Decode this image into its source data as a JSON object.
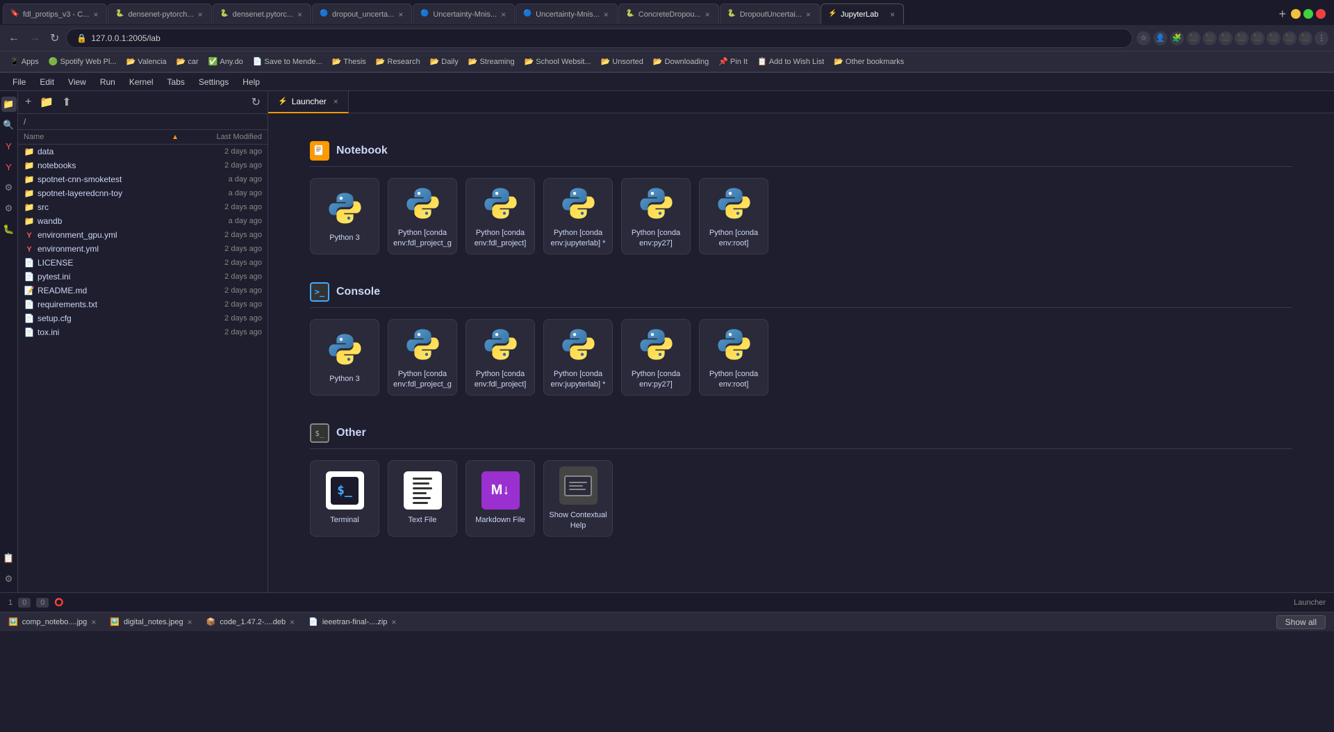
{
  "browser": {
    "tabs": [
      {
        "id": "t1",
        "favicon": "🔖",
        "favicon_color": "fav-orange",
        "title": "fdl_protips_v3 - C...",
        "active": false,
        "closable": true
      },
      {
        "id": "t2",
        "favicon": "🐍",
        "favicon_color": "fav-blue",
        "title": "densenet-pytorch...",
        "active": false,
        "closable": true
      },
      {
        "id": "t3",
        "favicon": "🐍",
        "favicon_color": "fav-blue",
        "title": "densenet.pytorc...",
        "active": false,
        "closable": true
      },
      {
        "id": "t4",
        "favicon": "🔵",
        "favicon_color": "fav-blue",
        "title": "dropout_uncerta...",
        "active": false,
        "closable": true
      },
      {
        "id": "t5",
        "favicon": "🔵",
        "favicon_color": "fav-blue",
        "title": "Uncertainty-Mnis...",
        "active": false,
        "closable": true
      },
      {
        "id": "t6",
        "favicon": "🔵",
        "favicon_color": "fav-blue",
        "title": "Uncertainty-Mnis...",
        "active": false,
        "closable": true
      },
      {
        "id": "t7",
        "favicon": "🐍",
        "favicon_color": "fav-blue",
        "title": "ConcreteDropou...",
        "active": false,
        "closable": true
      },
      {
        "id": "t8",
        "favicon": "🐍",
        "favicon_color": "fav-blue",
        "title": "DropoutUncertai...",
        "active": false,
        "closable": true
      },
      {
        "id": "t9",
        "favicon": "⚡",
        "favicon_color": "fav-orange",
        "title": "JupyterLab",
        "active": true,
        "closable": true
      }
    ],
    "url": "127.0.0.1:2005/lab",
    "bookmarks": [
      {
        "icon": "📱",
        "label": "Apps"
      },
      {
        "icon": "🟢",
        "label": "Spotify Web Pl..."
      },
      {
        "icon": "📂",
        "label": "Valencia"
      },
      {
        "icon": "📂",
        "label": "car"
      },
      {
        "icon": "✅",
        "label": "Any.do"
      },
      {
        "icon": "📄",
        "label": "Save to Mende..."
      },
      {
        "icon": "📂",
        "label": "Thesis"
      },
      {
        "icon": "📂",
        "label": "Research"
      },
      {
        "icon": "📂",
        "label": "Daily"
      },
      {
        "icon": "📂",
        "label": "Streaming"
      },
      {
        "icon": "📂",
        "label": "School Websit..."
      },
      {
        "icon": "📂",
        "label": "Unsorted"
      },
      {
        "icon": "📂",
        "label": "Downloading"
      },
      {
        "icon": "📌",
        "label": "Pin It"
      },
      {
        "icon": "📋",
        "label": "Add to Wish List"
      },
      {
        "icon": "📂",
        "label": "Other bookmarks"
      }
    ]
  },
  "app": {
    "menu_items": [
      "File",
      "Edit",
      "View",
      "Run",
      "Kernel",
      "Tabs",
      "Settings",
      "Help"
    ]
  },
  "sidebar_icons": [
    "files",
    "search",
    "git",
    "extensions",
    "build",
    "debug"
  ],
  "file_panel": {
    "breadcrumb": "/",
    "columns": {
      "name": "Name",
      "modified": "Last Modified"
    },
    "sort_icon": "▲",
    "items": [
      {
        "type": "folder",
        "name": "data",
        "modified": "2 days ago"
      },
      {
        "type": "folder",
        "name": "notebooks",
        "modified": "2 days ago"
      },
      {
        "type": "folder",
        "name": "spotnet-cnn-smoketest",
        "modified": "a day ago"
      },
      {
        "type": "folder",
        "name": "spotnet-layeredcnn-toy",
        "modified": "a day ago"
      },
      {
        "type": "folder",
        "name": "src",
        "modified": "2 days ago"
      },
      {
        "type": "folder",
        "name": "wandb",
        "modified": "a day ago"
      },
      {
        "type": "yaml",
        "name": "environment_gpu.yml",
        "modified": "2 days ago"
      },
      {
        "type": "yaml",
        "name": "environment.yml",
        "modified": "2 days ago"
      },
      {
        "type": "file",
        "name": "LICENSE",
        "modified": "2 days ago"
      },
      {
        "type": "file",
        "name": "pytest.ini",
        "modified": "2 days ago"
      },
      {
        "type": "markdown",
        "name": "README.md",
        "modified": "2 days ago"
      },
      {
        "type": "file",
        "name": "requirements.txt",
        "modified": "2 days ago"
      },
      {
        "type": "file",
        "name": "setup.cfg",
        "modified": "2 days ago"
      },
      {
        "type": "file",
        "name": "tox.ini",
        "modified": "2 days ago"
      }
    ]
  },
  "launcher": {
    "tab_label": "Launcher",
    "sections": {
      "notebook": {
        "title": "Notebook",
        "kernels": [
          {
            "label": "Python 3"
          },
          {
            "label": "Python [conda env:fdl_project_g"
          },
          {
            "label": "Python [conda env:fdl_project]"
          },
          {
            "label": "Python [conda env:jupyterlab] *"
          },
          {
            "label": "Python [conda env:py27]"
          },
          {
            "label": "Python [conda env:root]"
          }
        ]
      },
      "console": {
        "title": "Console",
        "kernels": [
          {
            "label": "Python 3"
          },
          {
            "label": "Python [conda env:fdl_project_g"
          },
          {
            "label": "Python [conda env:fdl_project]"
          },
          {
            "label": "Python [conda env:jupyterlab] *"
          },
          {
            "label": "Python [conda env:py27]"
          },
          {
            "label": "Python [conda env:root]"
          }
        ]
      },
      "other": {
        "title": "Other",
        "items": [
          {
            "type": "terminal",
            "label": "Terminal"
          },
          {
            "type": "textfile",
            "label": "Text File"
          },
          {
            "type": "markdown",
            "label": "Markdown File"
          },
          {
            "type": "help",
            "label": "Show Contextual Help"
          }
        ]
      }
    }
  },
  "status_bar": {
    "left": [
      "0",
      "0"
    ],
    "right": "Launcher"
  },
  "download_bar": {
    "items": [
      {
        "icon": "🖼️",
        "label": "comp_notebo....jpg"
      },
      {
        "icon": "🖼️",
        "label": "digital_notes.jpeg"
      },
      {
        "icon": "📦",
        "label": "code_1.47.2-....deb"
      },
      {
        "icon": "📄",
        "label": "ieeetran-final-....zip"
      }
    ],
    "show_all_label": "Show all"
  }
}
